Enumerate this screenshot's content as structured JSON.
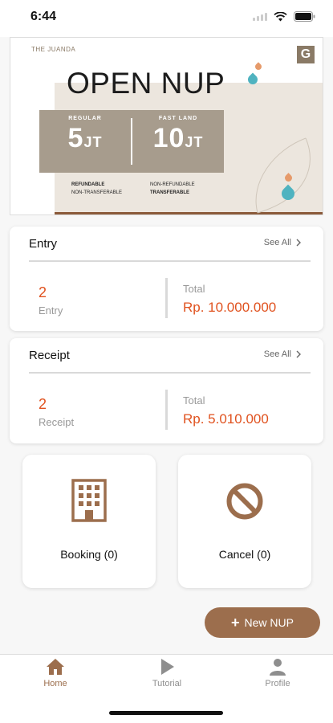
{
  "status": {
    "time": "6:44"
  },
  "banner": {
    "brand": "THE JUANDA",
    "title": "OPEN NUP",
    "regular_label": "REGULAR",
    "regular_value": "5",
    "regular_unit": "JT",
    "fastland_label": "FAST LAND",
    "fastland_value": "10",
    "fastland_unit": "JT",
    "regular_terms_1": "REFUNDABLE",
    "regular_terms_2": "NON-TRANSFERABLE",
    "fastland_terms_1": "NON-REFUNDABLE",
    "fastland_terms_2": "TRANSFERABLE",
    "logo_letter": "G"
  },
  "entry": {
    "title": "Entry",
    "see_all": "See All",
    "count": "2",
    "count_label": "Entry",
    "total_label": "Total",
    "total_value": "Rp. 10.000.000"
  },
  "receipt": {
    "title": "Receipt",
    "see_all": "See All",
    "count": "2",
    "count_label": "Receipt",
    "total_label": "Total",
    "total_value": "Rp. 5.010.000"
  },
  "tiles": {
    "booking": "Booking (0)",
    "cancel": "Cancel (0)"
  },
  "fab": {
    "plus": "+",
    "label": "New NUP"
  },
  "nav": {
    "home": "Home",
    "tutorial": "Tutorial",
    "profile": "Profile"
  },
  "colors": {
    "accent": "#9c6e4d",
    "value_orange": "#e0521f",
    "nav_inactive": "#8e8e8e"
  }
}
